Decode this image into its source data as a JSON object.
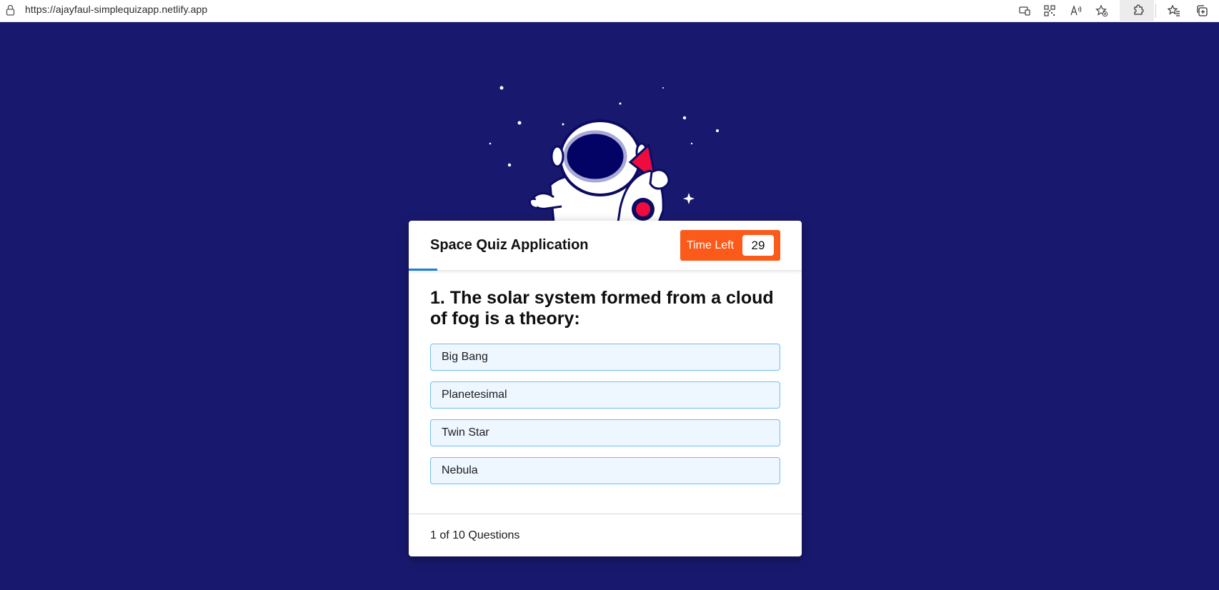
{
  "browser": {
    "url": "https://ajayfaul-simplequizapp.netlify.app",
    "icons": [
      "lock-icon",
      "app-available-icon",
      "qr-code-icon",
      "read-aloud-icon",
      "favorite-add-icon",
      "extensions-icon",
      "favorites-icon",
      "collections-icon"
    ]
  },
  "colors": {
    "background": "#18196e",
    "timer": "#fb5a1a",
    "accent": "#1c7ed6",
    "option_bg": "#eef6ff",
    "option_border": "#74bdf0"
  },
  "quiz": {
    "title": "Space Quiz Application",
    "timer_label": "Time Left",
    "timer_value": "29",
    "question": "1. The solar system formed from a cloud of fog is a theory:",
    "options": [
      {
        "label": "Big Bang"
      },
      {
        "label": "Planetesimal"
      },
      {
        "label": "Twin Star"
      },
      {
        "label": "Nebula"
      }
    ],
    "progress_fraction": 0.1,
    "footer": "1 of 10 Questions"
  }
}
